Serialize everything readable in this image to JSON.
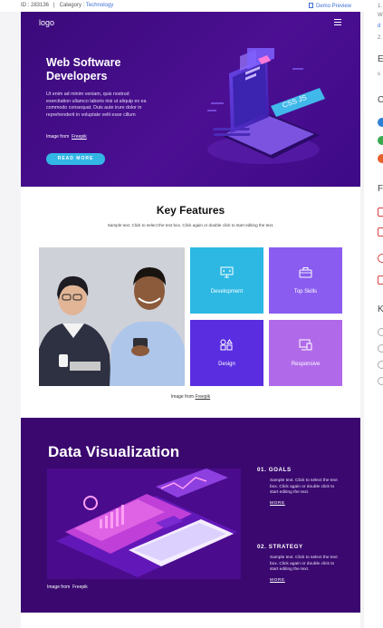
{
  "topbar": {
    "id_label": "ID : 283136",
    "separator": "|",
    "category_label": "Category :",
    "category_value": "Technology",
    "preview_label": "Demo Preview"
  },
  "rightcol": {
    "line1": "1.",
    "line2": "W",
    "line3": "d",
    "line4": "2.",
    "head1": "E",
    "line5": "s",
    "head2": "C",
    "head3": "F",
    "head4": "K"
  },
  "hero": {
    "logo": "logo",
    "title": "Web Software Developers",
    "body": "Ut enim ad minim veniam, quis nostrud exercitation ullamco laboris nisi ut aliquip ex ea commodo consequat. Duis aute irure dolor in reprehenderit in voluptate velit esse cillum",
    "credit_prefix": "Image from",
    "credit_link": "Freepik",
    "button": "READ MORE"
  },
  "features": {
    "title": "Key Features",
    "subtitle": "Sample text. Click to select the text box. Click again or double click to start editing the text.",
    "tiles": [
      {
        "label": "Development",
        "color": "#2cb8e3"
      },
      {
        "label": "Top Skills",
        "color": "#8a5cf0"
      },
      {
        "label": "Design",
        "color": "#5a2ee0"
      },
      {
        "label": "Responsive",
        "color": "#b069e8"
      }
    ],
    "credit_prefix": "Image from",
    "credit_link": "Freepik"
  },
  "dataviz": {
    "title": "Data Visualization",
    "credit_prefix": "Image from",
    "credit_link": "Freepik",
    "items": [
      {
        "heading": "01. GOALS",
        "text": "Sample text. Click to select the text box. Click again or double click to start editing the text.",
        "more": "MORE"
      },
      {
        "heading": "02. STRATEGY",
        "text": "Sample text. Click to select the text box. Click again or double click to start editing the text.",
        "more": "MORE"
      }
    ]
  },
  "colors": {
    "hero_bg": "#4c0f93",
    "dataviz_bg": "#3a086f",
    "accent_button": "#33b6e5",
    "link": "#3b6fd6"
  }
}
